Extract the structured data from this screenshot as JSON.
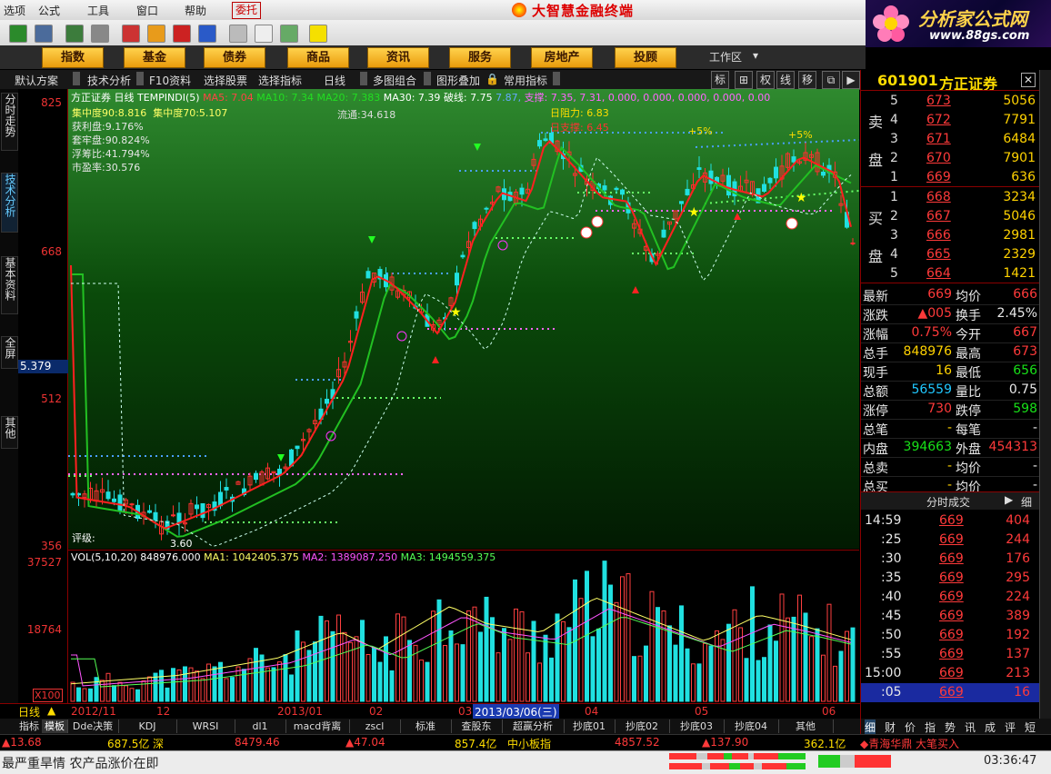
{
  "menu": {
    "items": [
      "选项",
      "公式",
      "工具",
      "窗口",
      "帮助"
    ],
    "tab": "委托"
  },
  "app": {
    "title": "大智慧金融终端"
  },
  "brand": {
    "name": "分析家公式网",
    "url": "www.88gs.com"
  },
  "categories": [
    "指数",
    "基金",
    "债券",
    "商品",
    "资讯",
    "服务",
    "房地产",
    "投顾"
  ],
  "workarea_label": "工作区",
  "submenu": [
    "默认方案",
    "技术分析",
    "F10资料",
    "选择股票",
    "选择指标",
    "日线",
    "多图组合",
    "图形叠加",
    "常用指标"
  ],
  "modes": [
    "标",
    "权",
    "线",
    "移",
    "还"
  ],
  "left_tabs": [
    "分时走势",
    "技术分析",
    "基本资料",
    "全屏",
    "其他"
  ],
  "yaxis": {
    "price_ticks": [
      "825",
      "668",
      "512",
      "356"
    ],
    "vol_ticks": [
      "37527",
      "18764"
    ],
    "vol_unit": "X100",
    "cursor_value": "5.379"
  },
  "price_header": {
    "name": "方正证券 日线",
    "indicator": "TEMPINDI(5)",
    "ma5": "MA5: 7.04",
    "ma10": "MA10: 7.34",
    "ma20": "MA20: 7.383",
    "ma30": "MA30: 7.39",
    "break": "破线: 7.75",
    "support": "支撑: 7.35, 7.31, 0.000, 0.000, 0.000, 0.000, 0.00",
    "tail_a": "7.87,",
    "tail_b": "0.000, 0.000, 0.000, 0.000, 0.00"
  },
  "chips": {
    "c90": "集中度90:8.816",
    "c70": "集中度70:5.107",
    "profit": "获利盘:9.176%",
    "trapped": "套牢盘:90.824%",
    "float_ratio": "浮筹比:41.794%",
    "pe": "市盈率:30.576",
    "circulation": "流通:34.618",
    "rating": "评级:"
  },
  "chart_labels": {
    "resist": "日阻力: 6.83",
    "support_mark": "日支撑: 6.45",
    "pct1": "+5%",
    "pct2": "+5%",
    "low": "3.60"
  },
  "vol_header": {
    "name": "VOL(5,10,20)",
    "value": "848976.000",
    "ma1": "MA1: 1042405.375",
    "ma2": "MA2: 1389087.250",
    "ma3": "MA3: 1494559.375"
  },
  "dates": [
    "2012/11",
    "12",
    "2013/01",
    "02",
    "03",
    "04",
    "05",
    "06"
  ],
  "date_cursor": "2013/03/06(三)",
  "period_label": "日线",
  "bottom_tabs": [
    "指标",
    "模板",
    "Dde决策",
    "KDJ",
    "WRSI",
    "dl1",
    "macd背离",
    "zscl",
    "标准",
    "查股东",
    "超赢分析",
    "抄底01",
    "抄底02",
    "抄底03",
    "抄底04",
    "其他"
  ],
  "right_tabs": [
    "细",
    "财",
    "价",
    "指",
    "势",
    "讯",
    "成",
    "评",
    "短"
  ],
  "stock": {
    "code": "601901",
    "name": "方正证券"
  },
  "sell_label": [
    "卖",
    "盘"
  ],
  "buy_label": [
    "买",
    "盘"
  ],
  "sells": [
    {
      "lv": "5",
      "p": "673",
      "v": "5056"
    },
    {
      "lv": "4",
      "p": "672",
      "v": "7791"
    },
    {
      "lv": "3",
      "p": "671",
      "v": "6484"
    },
    {
      "lv": "2",
      "p": "670",
      "v": "7901"
    },
    {
      "lv": "1",
      "p": "669",
      "v": "636"
    }
  ],
  "buys": [
    {
      "lv": "1",
      "p": "668",
      "v": "3234"
    },
    {
      "lv": "2",
      "p": "667",
      "v": "5046"
    },
    {
      "lv": "3",
      "p": "666",
      "v": "2981"
    },
    {
      "lv": "4",
      "p": "665",
      "v": "2329"
    },
    {
      "lv": "5",
      "p": "664",
      "v": "1421"
    }
  ],
  "quote": [
    {
      "l1": "最新",
      "v1": "669",
      "l2": "均价",
      "v2": "666"
    },
    {
      "l1": "涨跌",
      "v1": "▲005",
      "l2": "换手",
      "v2": "2.45%"
    },
    {
      "l1": "涨幅",
      "v1": "0.75%",
      "l2": "今开",
      "v2": "667"
    },
    {
      "l1": "总手",
      "v1": "848976",
      "l2": "最高",
      "v2": "673"
    },
    {
      "l1": "现手",
      "v1": "16",
      "l2": "最低",
      "v2": "656"
    },
    {
      "l1": "总额",
      "v1": "56559",
      "l2": "量比",
      "v2": "0.75"
    },
    {
      "l1": "涨停",
      "v1": "730",
      "l2": "跌停",
      "v2": "598"
    },
    {
      "l1": "总笔",
      "v1": "-",
      "l2": "每笔",
      "v2": "-"
    },
    {
      "l1": "内盘",
      "v1": "394663",
      "l2": "外盘",
      "v2": "454313"
    },
    {
      "l1": "总卖",
      "v1": "-",
      "l2": "均价",
      "v2": "-"
    },
    {
      "l1": "总买",
      "v1": "-",
      "l2": "均价",
      "v2": "-"
    }
  ],
  "ticks_title": "分时成交",
  "ticks_more": "细",
  "ticks": [
    {
      "t": "14:59",
      "p": "669",
      "v": "404"
    },
    {
      "t": ":25",
      "p": "669",
      "v": "244"
    },
    {
      "t": ":30",
      "p": "669",
      "v": "176"
    },
    {
      "t": ":35",
      "p": "669",
      "v": "295"
    },
    {
      "t": ":40",
      "p": "669",
      "v": "224"
    },
    {
      "t": ":45",
      "p": "669",
      "v": "389"
    },
    {
      "t": ":50",
      "p": "669",
      "v": "192"
    },
    {
      "t": ":55",
      "p": "669",
      "v": "137"
    },
    {
      "t": "15:00",
      "p": "669",
      "v": "213"
    },
    {
      "t": ":05",
      "p": "669",
      "v": "16"
    }
  ],
  "index_bar": {
    "i1": "▲13.68",
    "i2": "687.5亿",
    "i3": "深",
    "i4": "8479.46",
    "i5": "▲47.04",
    "i6": "857.4亿",
    "i7": "中小板指",
    "i8": "4857.52",
    "i9": "▲137.90",
    "i10": "362.1亿",
    "i11": "◆青海华鼎 大笔买入"
  },
  "status": {
    "text": "最严重旱情 农产品涨价在即",
    "time": "03:36:47"
  }
}
